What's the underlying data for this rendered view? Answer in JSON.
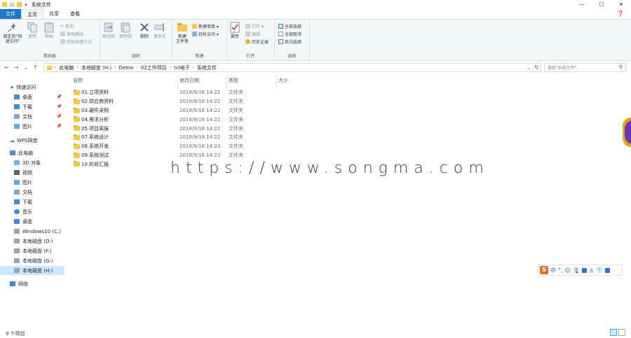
{
  "window": {
    "title": "系统文件",
    "controls": [
      "—",
      "☐",
      "✕"
    ]
  },
  "ribbon_tabs": [
    "文件",
    "主页",
    "共享",
    "查看"
  ],
  "ribbon": {
    "clipboard": {
      "pin_label": "固定到\"快速访问\"",
      "copy": "复制",
      "paste": "粘贴",
      "cut": "剪切",
      "copy_path": "复制路径",
      "paste_shortcut": "粘贴快捷方式",
      "group": "剪贴板"
    },
    "organize": {
      "move_to": "移动到",
      "copy_to": "复制到",
      "delete": "删除",
      "rename": "重命名",
      "group": "组织"
    },
    "new": {
      "new_folder": "新建\n文件夹",
      "new_item": "新建项目 ▾",
      "easy_access": "轻松访问 ▾",
      "group": "新建"
    },
    "open": {
      "properties": "属性",
      "open": "打开 ▾",
      "edit": "编辑",
      "history": "历史记录",
      "group": "打开"
    },
    "select": {
      "select_all": "全部选择",
      "select_none": "全部取消",
      "invert": "反向选择",
      "group": "选择"
    }
  },
  "address": {
    "crumbs": [
      "此电脑",
      "本地磁盘 (H:)",
      "Demo",
      "02工作项目",
      "tcl电子",
      "系统文件"
    ],
    "search_placeholder": "搜索\"系统文件\""
  },
  "nav": {
    "quick_access": "快速访问",
    "quick_items": [
      "桌面",
      "下载",
      "文档",
      "图片"
    ],
    "wps": "WPS网盘",
    "this_pc": "此电脑",
    "pc_items": [
      "3D 对象",
      "视频",
      "图片",
      "文档",
      "下载",
      "音乐",
      "桌面",
      "Windows10 (C:)",
      "本地磁盘 (D:)",
      "本地磁盘 (F:)",
      "本地磁盘 (G:)",
      "本地磁盘 (H:)"
    ],
    "network": "网络"
  },
  "columns": {
    "name": "名称",
    "date": "修改日期",
    "type": "类型",
    "size": "大小"
  },
  "files": [
    {
      "name": "01.立项资料",
      "date": "2018/9/18 14:22",
      "type": "文件夹"
    },
    {
      "name": "02.供应商资料",
      "date": "2018/9/18 14:22",
      "type": "文件夹"
    },
    {
      "name": "03.硬件采购",
      "date": "2018/9/18 14:22",
      "type": "文件夹"
    },
    {
      "name": "04.需求分析",
      "date": "2018/9/18 14:22",
      "type": "文件夹"
    },
    {
      "name": "05.项目周报",
      "date": "2018/9/18 14:22",
      "type": "文件夹"
    },
    {
      "name": "07.系统设计",
      "date": "2018/9/18 14:22",
      "type": "文件夹"
    },
    {
      "name": "08.系统开发",
      "date": "2018/9/18 14:23",
      "type": "文件夹"
    },
    {
      "name": "09.系统测试",
      "date": "2018/9/18 14:23",
      "type": "文件夹"
    },
    {
      "name": "10.阶段汇报",
      "date": "2018/9/18 14:23",
      "type": "文件夹"
    }
  ],
  "watermark": "https://www.songma.com",
  "status": "9 个项目",
  "ime": {
    "logo": "S",
    "mode": "中",
    "punct": "°,"
  }
}
